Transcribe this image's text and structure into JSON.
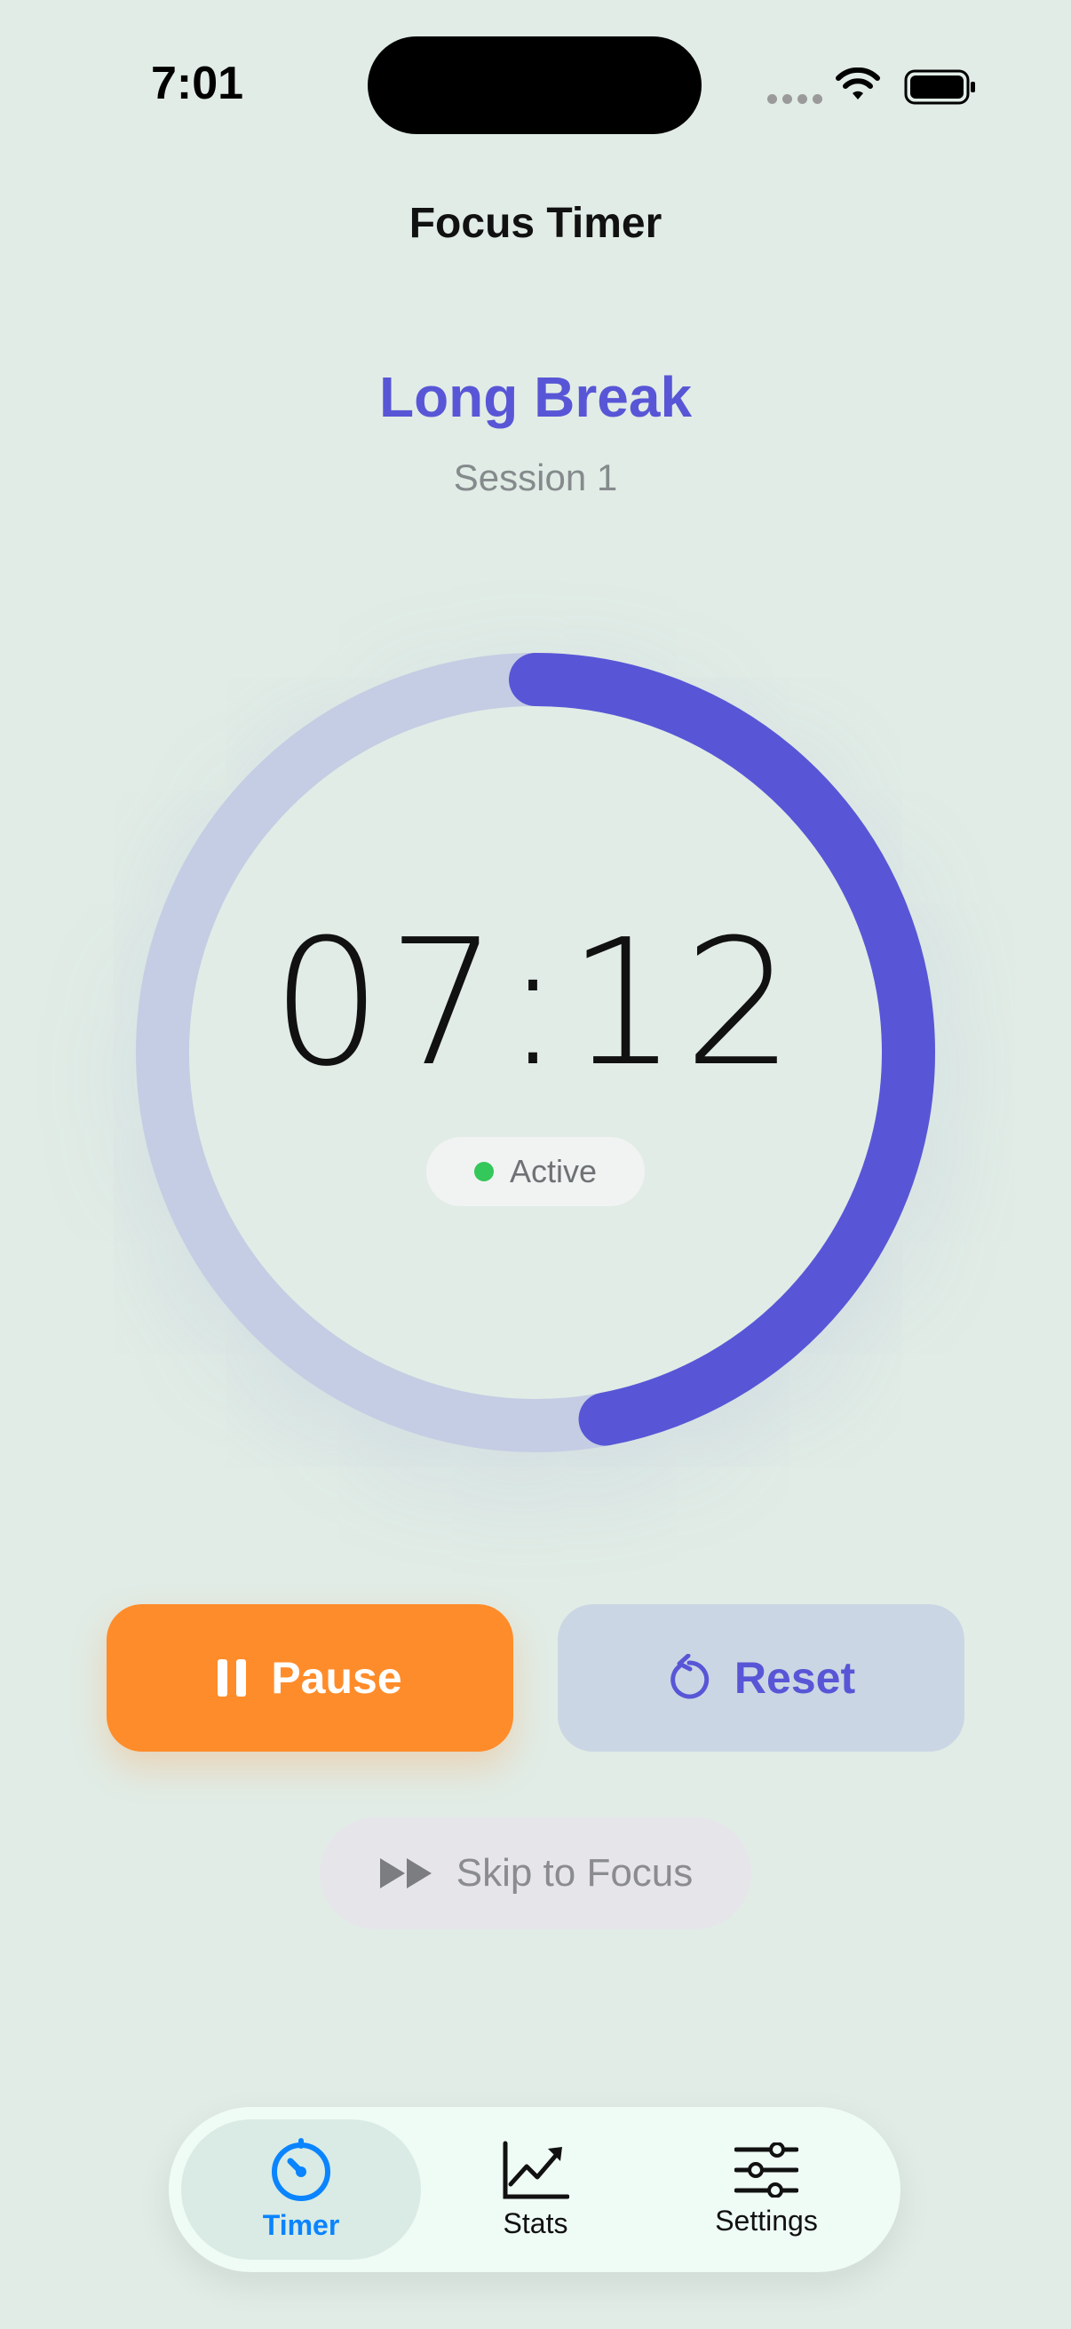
{
  "status_bar": {
    "time": "7:01",
    "icons": [
      "signal-dots-icon",
      "wifi-icon",
      "battery-icon"
    ]
  },
  "header": {
    "title": "Focus Timer"
  },
  "timer": {
    "mode": "Long Break",
    "session": "Session 1",
    "time_remaining": "07:12",
    "status": "Active",
    "progress": 0.47
  },
  "actions": {
    "pause_label": "Pause",
    "reset_label": "Reset",
    "skip_label": "Skip to Focus"
  },
  "tab_bar": {
    "tabs": [
      {
        "label": "Timer",
        "icon": "stopwatch-icon",
        "active": true
      },
      {
        "label": "Stats",
        "icon": "chart-icon",
        "active": false
      },
      {
        "label": "Settings",
        "icon": "sliders-icon",
        "active": false
      }
    ]
  },
  "colors": {
    "background": "#e1ece6",
    "accent": "#5856d6",
    "ring_track": "#c4cde3",
    "pause": "#ff8c2a",
    "active_dot": "#34c759",
    "tab_active": "#0a84ff"
  }
}
